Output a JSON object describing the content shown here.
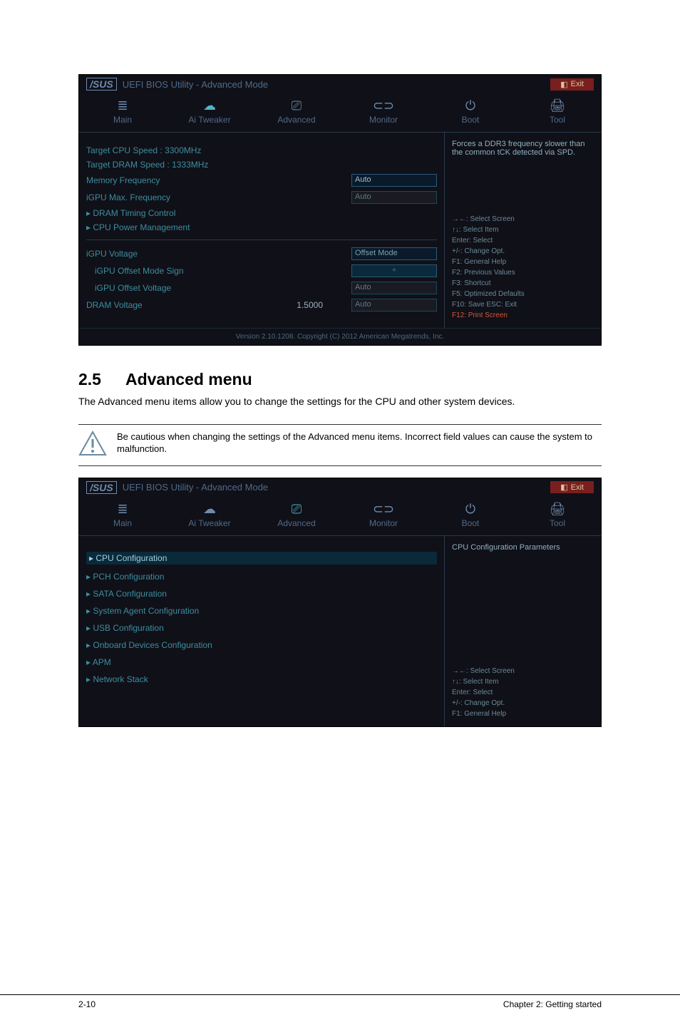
{
  "page": {
    "section_num": "2.5",
    "section_title": "Advanced menu",
    "intro": "The Advanced menu items allow you to change the settings for the CPU and other system devices.",
    "note": "Be cautious when changing the settings of the Advanced menu items. Incorrect field values can cause the system to malfunction.",
    "footer_left": "2-10",
    "footer_right": "Chapter 2: Getting started"
  },
  "bios_common": {
    "logo": "/SUS",
    "title": "UEFI BIOS Utility - Advanced Mode",
    "exit": "Exit",
    "tabs": {
      "main": "Main",
      "ai_tweaker": "Ai Tweaker",
      "advanced": "Advanced",
      "monitor": "Monitor",
      "boot": "Boot",
      "tool": "Tool"
    },
    "footer": "Version 2.10.1208. Copyright (C) 2012 American Megatrends, Inc."
  },
  "bios1": {
    "rows": {
      "target_cpu": {
        "label": "Target CPU Speed :",
        "value": "3300MHz"
      },
      "target_dram": {
        "label": "Target DRAM Speed :",
        "value": "1333MHz"
      },
      "memory_freq": {
        "label": "Memory Frequency",
        "value": "Auto"
      },
      "igpu_max": {
        "label": "iGPU Max. Frequency",
        "value": "Auto"
      },
      "dram_timing": {
        "label": "DRAM Timing Control"
      },
      "cpu_power": {
        "label": "CPU Power Management"
      },
      "igpu_voltage": {
        "label": "iGPU Voltage",
        "value": "Offset Mode"
      },
      "igpu_offset_sign": {
        "label": "iGPU Offset Mode Sign",
        "value": "+"
      },
      "igpu_offset_voltage": {
        "label": "iGPU Offset Voltage",
        "value": "Auto"
      },
      "dram_voltage": {
        "label": "DRAM Voltage",
        "static": "1.5000",
        "value": "Auto"
      }
    },
    "right": {
      "info": "Forces a DDR3 frequency slower than the common tCK detected via SPD.",
      "help": [
        "→←: Select Screen",
        "↑↓: Select Item",
        "Enter: Select",
        "+/-: Change Opt.",
        "F1: General Help",
        "F2: Previous Values",
        "F3: Shortcut",
        "F5: Optimized Defaults",
        "F10: Save  ESC: Exit",
        "F12: Print Screen"
      ]
    }
  },
  "bios2": {
    "items": [
      "CPU Configuration",
      "PCH Configuration",
      "SATA Configuration",
      "System Agent Configuration",
      "USB Configuration",
      "Onboard Devices Configuration",
      "APM",
      "Network Stack"
    ],
    "right_title": "CPU Configuration Parameters",
    "help": [
      "→←: Select Screen",
      "↑↓: Select Item",
      "Enter: Select",
      "+/-: Change Opt.",
      "F1: General Help"
    ]
  }
}
